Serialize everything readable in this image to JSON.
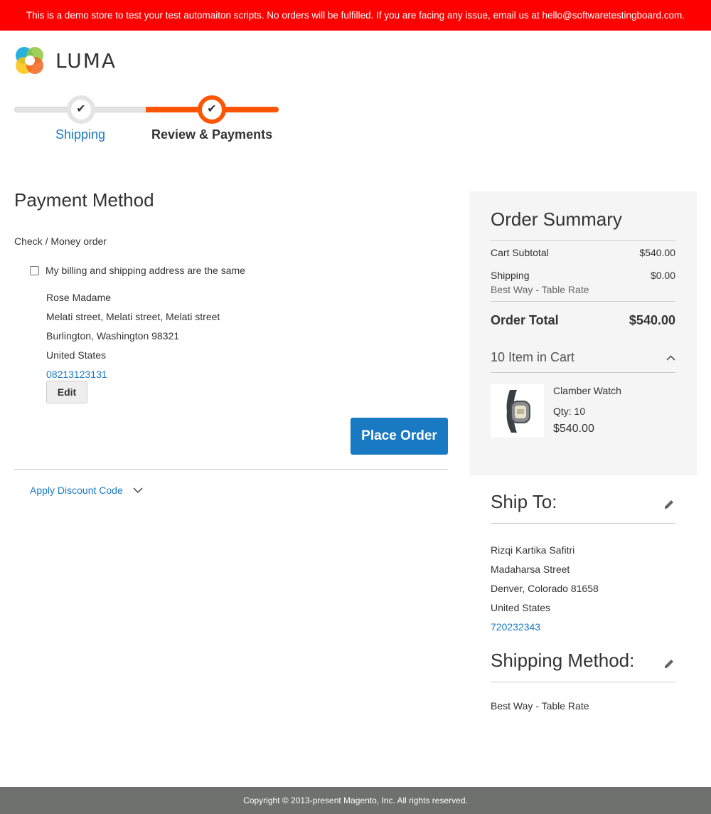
{
  "banner": {
    "text": "This is a demo store to test your test automaiton scripts. No orders will be fulfilled. If you are facing any issue, email us at hello@softwaretestingboard.com."
  },
  "logo": {
    "text": "LUMA"
  },
  "progress": {
    "steps": [
      {
        "label": "Shipping",
        "state": "complete"
      },
      {
        "label": "Review & Payments",
        "state": "active"
      }
    ]
  },
  "payment": {
    "title": "Payment Method",
    "method": "Check / Money order",
    "billing_same_label": "My billing and shipping address are the same",
    "billing_same_checked": false,
    "address": {
      "name": "Rose Madame",
      "street": "Melati street, Melati street, Melati street",
      "city_line": "Burlington, Washington 98321",
      "country": "United States",
      "phone": "08213123131"
    },
    "edit_label": "Edit",
    "place_order_label": "Place Order",
    "discount_label": "Apply Discount Code"
  },
  "summary": {
    "title": "Order Summary",
    "cart_subtotal_label": "Cart Subtotal",
    "cart_subtotal_value": "$540.00",
    "shipping_label": "Shipping",
    "shipping_value": "$0.00",
    "shipping_method": "Best Way - Table Rate",
    "order_total_label": "Order Total",
    "order_total_value": "$540.00",
    "items_in_cart": "10 Item in Cart",
    "item": {
      "name": "Clamber Watch",
      "qty": "Qty: 10",
      "price": "$540.00"
    }
  },
  "ship_to": {
    "title": "Ship To:",
    "name": "Rizqi Kartika Safitri",
    "street": "Madaharsa Street",
    "city_line": "Denver, Colorado 81658",
    "country": "United States",
    "phone": "720232343"
  },
  "shipping_method": {
    "title": "Shipping Method:",
    "value": "Best Way - Table Rate"
  },
  "footer": {
    "text": "Copyright © 2013-present Magento, Inc. All rights reserved."
  },
  "colors": {
    "accent": "#1979c2",
    "progress_active": "#ff5501",
    "banner": "#ff0000",
    "footer": "#6e716e"
  }
}
